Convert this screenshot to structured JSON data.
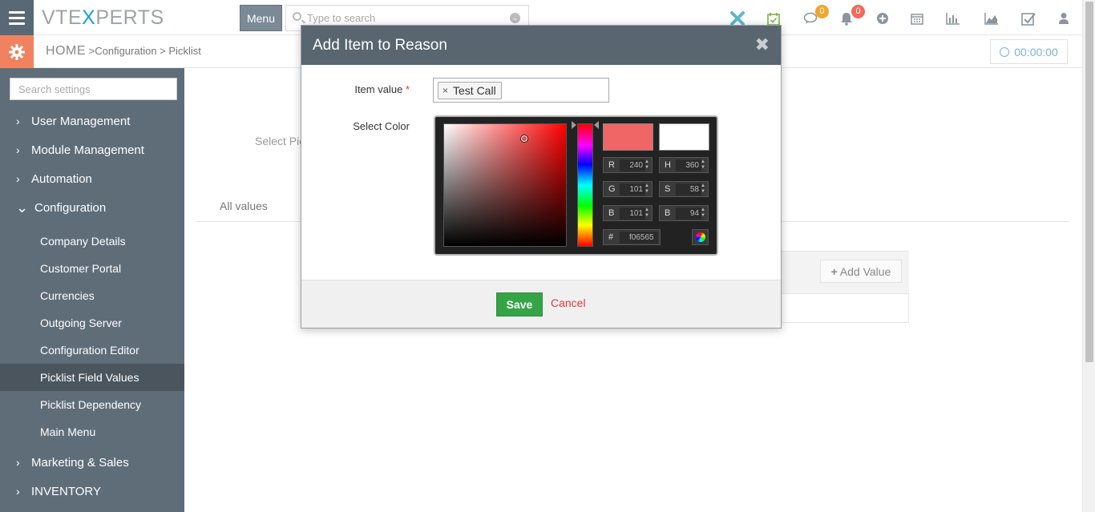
{
  "app": {
    "logo_left": "VTE",
    "logo_x": "X",
    "logo_right": "PERTS",
    "menu_label": "Menu",
    "search_placeholder": "Type to search"
  },
  "badges": {
    "chat_count": "0",
    "notifications_count": "0"
  },
  "breadcrumb": {
    "home": "HOME",
    "sep1": ">",
    "configuration": "Configuration",
    "sep2": ">",
    "picklist": "Picklist"
  },
  "timer": "00:00:00",
  "sidebar": {
    "search_placeholder": "Search settings",
    "sections": [
      {
        "label": "User Management",
        "arrow": "›"
      },
      {
        "label": "Module Management",
        "arrow": "›"
      },
      {
        "label": "Automation",
        "arrow": "›"
      },
      {
        "label": "Configuration",
        "arrow": "⌄"
      },
      {
        "label": "Marketing & Sales",
        "arrow": "›"
      },
      {
        "label": "INVENTORY",
        "arrow": "›"
      }
    ],
    "config_items": [
      {
        "label": "Company Details"
      },
      {
        "label": "Customer Portal"
      },
      {
        "label": "Currencies"
      },
      {
        "label": "Outgoing Server"
      },
      {
        "label": "Configuration Editor"
      },
      {
        "label": "Picklist Field Values",
        "active": true
      },
      {
        "label": "Picklist Dependency"
      },
      {
        "label": "Main Menu"
      }
    ]
  },
  "main": {
    "select_label": "Select Pic",
    "tab_all_values": "All values",
    "add_value_label": "Add Value"
  },
  "modal": {
    "title": "Add Item to Reason",
    "item_value_label": "Item value",
    "required_mark": "*",
    "item_tag": "Test Call",
    "select_color_label": "Select Color",
    "picker": {
      "r": "240",
      "g": "101",
      "b": "101",
      "h": "360",
      "s": "58",
      "bv": "94",
      "hex": "f06565",
      "labels": {
        "r": "R",
        "g": "G",
        "b": "B",
        "h": "H",
        "s": "S",
        "bv": "B",
        "hex": "#"
      },
      "new_color": "#f06565",
      "current_color": "#ffffff"
    },
    "save_label": "Save",
    "cancel_label": "Cancel"
  },
  "colors": {
    "sidebar_bg": "#5f6d79",
    "header_bg": "#59656f",
    "accent_orange": "#f0825f",
    "save_green": "#35a447",
    "cancel_red": "#e53935"
  }
}
